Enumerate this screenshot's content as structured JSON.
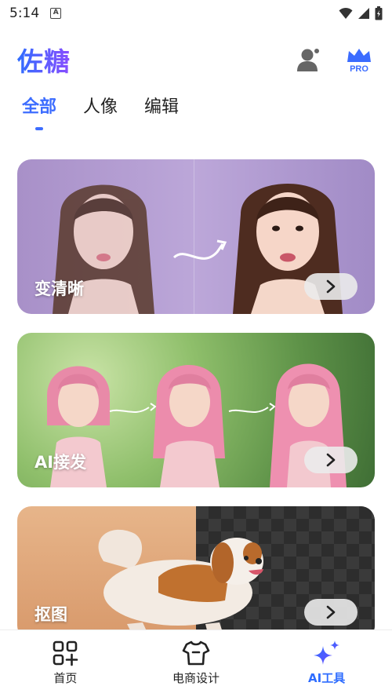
{
  "status": {
    "time": "5:14",
    "notif_letter": "A"
  },
  "header": {
    "title": "佐糖",
    "pro_label": "PRO"
  },
  "tabs": [
    {
      "label": "全部",
      "active": true
    },
    {
      "label": "人像",
      "active": false
    },
    {
      "label": "编辑",
      "active": false
    }
  ],
  "cards": [
    {
      "label": "变清晰"
    },
    {
      "label": "AI接发"
    },
    {
      "label": "抠图"
    }
  ],
  "nav": [
    {
      "label": "首页",
      "icon": "grid-plus-icon"
    },
    {
      "label": "电商设计",
      "icon": "tshirt-icon"
    },
    {
      "label": "AI工具",
      "icon": "sparkle-icon",
      "active": true
    }
  ],
  "colors": {
    "accent": "#3d6dff",
    "brand_gradient_start": "#2f6dff",
    "brand_gradient_end": "#8a4dff",
    "pro_crown": "#3b6cff"
  }
}
